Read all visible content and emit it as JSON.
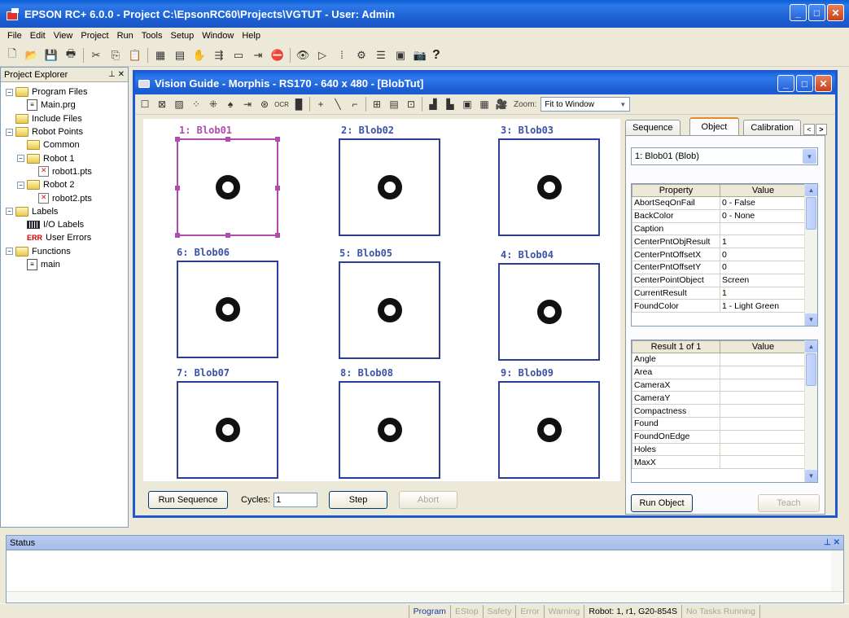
{
  "app": {
    "title": "EPSON RC+ 6.0.0 - Project C:\\EpsonRC60\\Projects\\VGTUT - User: Admin"
  },
  "menu": [
    "File",
    "Edit",
    "View",
    "Project",
    "Run",
    "Tools",
    "Setup",
    "Window",
    "Help"
  ],
  "explorer": {
    "title": "Project Explorer",
    "items": [
      {
        "label": "Program Files",
        "type": "folder",
        "level": 0,
        "expander": "−"
      },
      {
        "label": "Main.prg",
        "type": "file",
        "level": 1
      },
      {
        "label": "Include Files",
        "type": "folder",
        "level": 0
      },
      {
        "label": "Robot Points",
        "type": "folder",
        "level": 0,
        "expander": "−"
      },
      {
        "label": "Common",
        "type": "folder",
        "level": 1
      },
      {
        "label": "Robot 1",
        "type": "folder",
        "level": 1,
        "expander": "−"
      },
      {
        "label": "robot1.pts",
        "type": "pts",
        "level": 2
      },
      {
        "label": "Robot 2",
        "type": "folder",
        "level": 1,
        "expander": "−"
      },
      {
        "label": "robot2.pts",
        "type": "pts",
        "level": 2
      },
      {
        "label": "Labels",
        "type": "folder",
        "level": 0,
        "expander": "−"
      },
      {
        "label": "I/O Labels",
        "type": "labels",
        "level": 1
      },
      {
        "label": "User Errors",
        "type": "errors",
        "level": 1
      },
      {
        "label": "Functions",
        "type": "folder",
        "level": 0,
        "expander": "−"
      },
      {
        "label": "main",
        "type": "file",
        "level": 1
      }
    ]
  },
  "vision": {
    "title": "Vision Guide - Morphis - RS170 - 640 x 480 - [BlobTut]",
    "zoom_label": "Zoom:",
    "zoom_value": "Fit to Window",
    "blobs": [
      "1: Blob01",
      "2: Blob02",
      "3: Blob03",
      "6: Blob06",
      "5: Blob05",
      "4: Blob04",
      "7: Blob07",
      "8: Blob08",
      "9: Blob09"
    ],
    "run_sequence": "Run Sequence",
    "cycles_label": "Cycles:",
    "cycles_value": "1",
    "step": "Step",
    "abort": "Abort"
  },
  "panel": {
    "tabs": [
      "Sequence",
      "Object",
      "Calibration"
    ],
    "active_tab": "Object",
    "object_selected": "1: Blob01 (Blob)",
    "prop_headers": [
      "Property",
      "Value"
    ],
    "properties": [
      [
        "AbortSeqOnFail",
        "0 - False"
      ],
      [
        "BackColor",
        "0 - None"
      ],
      [
        "Caption",
        ""
      ],
      [
        "CenterPntObjResult",
        "1"
      ],
      [
        "CenterPntOffsetX",
        "0"
      ],
      [
        "CenterPntOffsetY",
        "0"
      ],
      [
        "CenterPointObject",
        "Screen"
      ],
      [
        "CurrentResult",
        "1"
      ],
      [
        "FoundColor",
        "1 - Light Green"
      ]
    ],
    "result_headers": [
      "Result 1 of 1",
      "Value"
    ],
    "results": [
      "Angle",
      "Area",
      "CameraX",
      "CameraY",
      "Compactness",
      "Found",
      "FoundOnEdge",
      "Holes",
      "MaxX"
    ],
    "run_object": "Run Object",
    "teach": "Teach"
  },
  "status": {
    "title": "Status"
  },
  "statusbar": {
    "program": "Program",
    "estop": "EStop",
    "safety": "Safety",
    "error": "Error",
    "warning": "Warning",
    "robot": "Robot: 1, r1, G20-854S",
    "tasks": "No Tasks Running"
  }
}
